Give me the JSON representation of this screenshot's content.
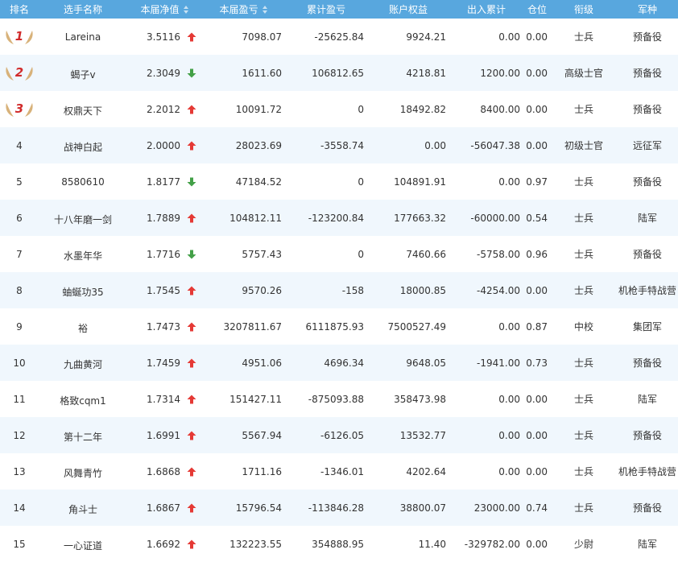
{
  "headers": [
    "排名",
    "选手名称",
    "本届净值",
    "本届盈亏",
    "累计盈亏",
    "账户权益",
    "出入累计",
    "仓位",
    "衔级",
    "军种"
  ],
  "colors": {
    "header_bg": "#58a7de",
    "row_alt": "#f0f7fd",
    "up": "#e53935",
    "down": "#43a047",
    "medal": "#d8b27a",
    "rank_num": "#d12b2b"
  },
  "rows": [
    {
      "rank": "1",
      "name": "Lareina",
      "nav": "3.5116",
      "trend": "up",
      "pl": "7098.07",
      "cum_pl": "-25625.84",
      "equity": "9924.21",
      "io": "0.00",
      "pos": "0.00",
      "title": "士兵",
      "army": "预备役"
    },
    {
      "rank": "2",
      "name": "蝎子v",
      "nav": "2.3049",
      "trend": "down",
      "pl": "1611.60",
      "cum_pl": "106812.65",
      "equity": "4218.81",
      "io": "1200.00",
      "pos": "0.00",
      "title": "高级士官",
      "army": "预备役"
    },
    {
      "rank": "3",
      "name": "权鼎天下",
      "nav": "2.2012",
      "trend": "up",
      "pl": "10091.72",
      "cum_pl": "0",
      "equity": "18492.82",
      "io": "8400.00",
      "pos": "0.00",
      "title": "士兵",
      "army": "预备役"
    },
    {
      "rank": "4",
      "name": "战神白起",
      "nav": "2.0000",
      "trend": "up",
      "pl": "28023.69",
      "cum_pl": "-3558.74",
      "equity": "0.00",
      "io": "-56047.38",
      "pos": "0.00",
      "title": "初级士官",
      "army": "远征军"
    },
    {
      "rank": "5",
      "name": "8580610",
      "nav": "1.8177",
      "trend": "down",
      "pl": "47184.52",
      "cum_pl": "0",
      "equity": "104891.91",
      "io": "0.00",
      "pos": "0.97",
      "title": "士兵",
      "army": "预备役"
    },
    {
      "rank": "6",
      "name": "十八年磨一剑",
      "nav": "1.7889",
      "trend": "up",
      "pl": "104812.11",
      "cum_pl": "-123200.84",
      "equity": "177663.32",
      "io": "-60000.00",
      "pos": "0.54",
      "title": "士兵",
      "army": "陆军"
    },
    {
      "rank": "7",
      "name": "水墨年华",
      "nav": "1.7716",
      "trend": "down",
      "pl": "5757.43",
      "cum_pl": "0",
      "equity": "7460.66",
      "io": "-5758.00",
      "pos": "0.96",
      "title": "士兵",
      "army": "预备役"
    },
    {
      "rank": "8",
      "name": "蚰蜒功35",
      "nav": "1.7545",
      "trend": "up",
      "pl": "9570.26",
      "cum_pl": "-158",
      "equity": "18000.85",
      "io": "-4254.00",
      "pos": "0.00",
      "title": "士兵",
      "army": "机枪手特战营"
    },
    {
      "rank": "9",
      "name": "裕",
      "nav": "1.7473",
      "trend": "up",
      "pl": "3207811.67",
      "cum_pl": "6111875.93",
      "equity": "7500527.49",
      "io": "0.00",
      "pos": "0.87",
      "title": "中校",
      "army": "集团军"
    },
    {
      "rank": "10",
      "name": "九曲黄河",
      "nav": "1.7459",
      "trend": "up",
      "pl": "4951.06",
      "cum_pl": "4696.34",
      "equity": "9648.05",
      "io": "-1941.00",
      "pos": "0.73",
      "title": "士兵",
      "army": "预备役"
    },
    {
      "rank": "11",
      "name": "格致cqm1",
      "nav": "1.7314",
      "trend": "up",
      "pl": "151427.11",
      "cum_pl": "-875093.88",
      "equity": "358473.98",
      "io": "0.00",
      "pos": "0.00",
      "title": "士兵",
      "army": "陆军"
    },
    {
      "rank": "12",
      "name": "第十二年",
      "nav": "1.6991",
      "trend": "up",
      "pl": "5567.94",
      "cum_pl": "-6126.05",
      "equity": "13532.77",
      "io": "0.00",
      "pos": "0.00",
      "title": "士兵",
      "army": "预备役"
    },
    {
      "rank": "13",
      "name": "风舞青竹",
      "nav": "1.6868",
      "trend": "up",
      "pl": "1711.16",
      "cum_pl": "-1346.01",
      "equity": "4202.64",
      "io": "0.00",
      "pos": "0.00",
      "title": "士兵",
      "army": "机枪手特战营"
    },
    {
      "rank": "14",
      "name": "角斗士",
      "nav": "1.6867",
      "trend": "up",
      "pl": "15796.54",
      "cum_pl": "-113846.28",
      "equity": "38800.07",
      "io": "23000.00",
      "pos": "0.74",
      "title": "士兵",
      "army": "预备役"
    },
    {
      "rank": "15",
      "name": "一心证道",
      "nav": "1.6692",
      "trend": "up",
      "pl": "132223.55",
      "cum_pl": "354888.95",
      "equity": "11.40",
      "io": "-329782.00",
      "pos": "0.00",
      "title": "少尉",
      "army": "陆军"
    }
  ]
}
